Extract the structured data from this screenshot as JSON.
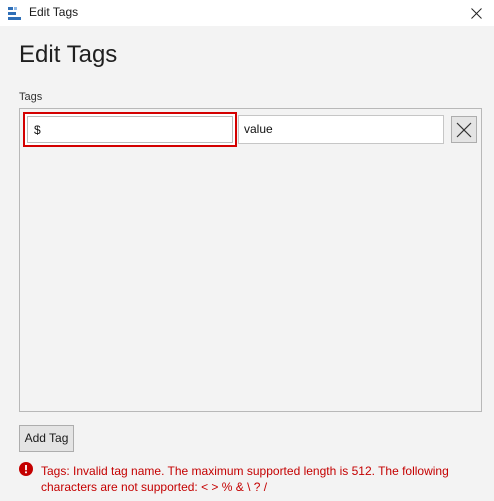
{
  "window": {
    "title": "Edit Tags"
  },
  "page": {
    "heading": "Edit Tags",
    "tags_label": "Tags"
  },
  "tags": [
    {
      "name": "$",
      "value": "value"
    }
  ],
  "buttons": {
    "add_tag": "Add Tag"
  },
  "error": {
    "message": "Tags: Invalid tag name. The maximum supported length is 512. The following characters are not supported: < > % & \\ ? /"
  },
  "colors": {
    "error": "#c40000",
    "invalid_border": "#d40000",
    "background": "#f3f3f3"
  },
  "icons": {
    "app": "blue-stacked-bars-icon",
    "close": "close-icon",
    "remove_tag": "x-icon",
    "error": "error-circle-icon"
  }
}
